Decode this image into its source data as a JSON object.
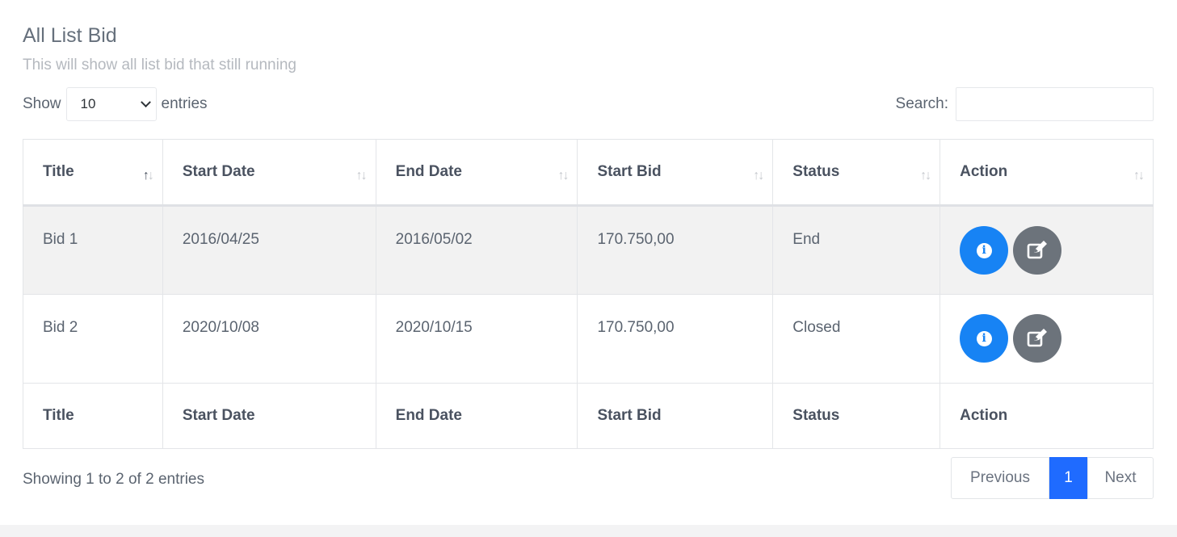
{
  "header": {
    "title": "All List Bid",
    "subtitle": "This will show all list bid that still running"
  },
  "length_control": {
    "prefix": "Show",
    "selected": "10",
    "suffix": "entries"
  },
  "search": {
    "label": "Search:",
    "value": "",
    "placeholder": ""
  },
  "table": {
    "columns": [
      "Title",
      "Start Date",
      "End Date",
      "Start Bid",
      "Status",
      "Action"
    ],
    "sorted_column": "Title",
    "sort_glyph_up": "↑",
    "sort_glyph_down": "↓",
    "rows": [
      {
        "title": "Bid 1",
        "start_date": "2016/04/25",
        "end_date": "2016/05/02",
        "start_bid": "170.750,00",
        "status": "End"
      },
      {
        "title": "Bid 2",
        "start_date": "2020/10/08",
        "end_date": "2020/10/15",
        "start_bid": "170.750,00",
        "status": "Closed"
      }
    ],
    "info_icon_glyph": "i"
  },
  "footer": {
    "info": "Showing 1 to 2 of 2 entries",
    "pagination": {
      "previous": "Previous",
      "current": "1",
      "next": "Next"
    }
  },
  "colors": {
    "info_button": "#1783f4",
    "edit_button": "#6c737b",
    "active_page": "#1f6bff"
  },
  "icons": {
    "info": "info-circle-icon",
    "edit": "edit-icon",
    "dropdown": "chevron-down-icon",
    "sort": "sort-icon"
  }
}
